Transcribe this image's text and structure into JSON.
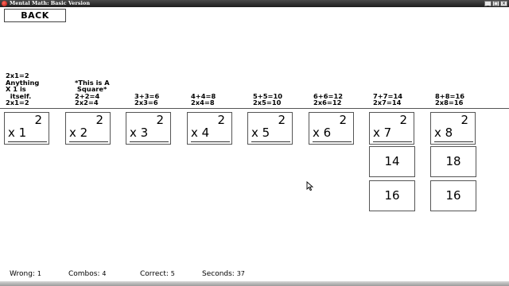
{
  "window": {
    "title": "Mental Math: Basic Version",
    "minimize_glyph": "_",
    "maximize_glyph": "□",
    "close_glyph": "×"
  },
  "back_label": "BACK",
  "hints": [
    "2x1=2\nAnything\nX 1 is\n  itself.\n2x1=2",
    "*This is A\n Square*\n2+2=4\n2x2=4",
    "3+3=6\n2x3=6",
    "4+4=8\n2x4=8",
    "5+5=10\n2x5=10",
    "6+6=12\n2x6=12",
    "7+7=14\n2x7=14",
    "8+8=16\n2x8=16"
  ],
  "cards": [
    {
      "top": "2",
      "bottom": "x 1"
    },
    {
      "top": "2",
      "bottom": "x 2"
    },
    {
      "top": "2",
      "bottom": "x 3"
    },
    {
      "top": "2",
      "bottom": "x 4"
    },
    {
      "top": "2",
      "bottom": "x 5"
    },
    {
      "top": "2",
      "bottom": "x 6"
    },
    {
      "top": "2",
      "bottom": "x 7"
    },
    {
      "top": "2",
      "bottom": "x 8"
    }
  ],
  "answers": {
    "col7": [
      "14",
      "16"
    ],
    "col8": [
      "18",
      "16"
    ]
  },
  "stats": {
    "wrong_label": "Wrong:",
    "wrong": "1",
    "combos_label": "Combos:",
    "combos": "4",
    "correct_label": "Correct:",
    "correct": "5",
    "seconds_label": "Seconds:",
    "seconds": "37"
  }
}
